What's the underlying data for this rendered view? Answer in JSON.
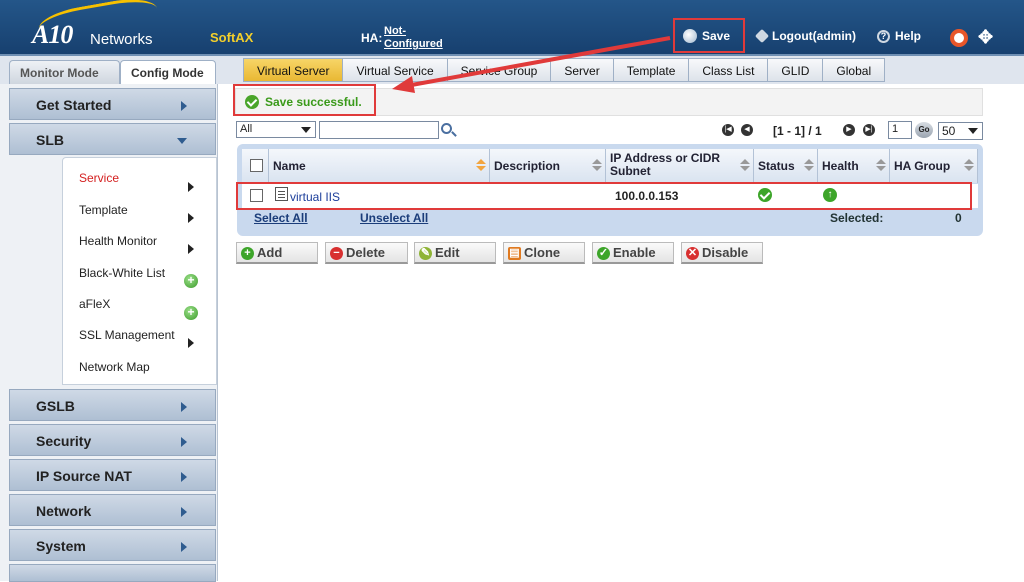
{
  "header": {
    "logo_a10": "A10",
    "logo_networks": "Networks",
    "product": "SoftAX",
    "ha_label": "HA:",
    "ha_value": "Not-Configured",
    "save_label": "Save",
    "logout_label": "Logout(admin)",
    "help_label": "Help"
  },
  "modes": {
    "monitor": "Monitor Mode",
    "config": "Config Mode"
  },
  "tabs": [
    {
      "label": "Virtual Server",
      "active": true
    },
    {
      "label": "Virtual Service"
    },
    {
      "label": "Service Group"
    },
    {
      "label": "Server"
    },
    {
      "label": "Template"
    },
    {
      "label": "Class List"
    },
    {
      "label": "GLID"
    },
    {
      "label": "Global"
    }
  ],
  "sidebar": {
    "get_started": "Get Started",
    "slb": "SLB",
    "slb_items": [
      "Service",
      "Template",
      "Health Monitor",
      "Black-White List",
      "aFleX",
      "SSL Management",
      "Network Map"
    ],
    "gslb": "GSLB",
    "security": "Security",
    "ip_source_nat": "IP Source NAT",
    "network": "Network",
    "system": "System"
  },
  "message": "Save successful.",
  "filter": {
    "select_value": "All",
    "search_value": ""
  },
  "pager": {
    "range": "[1 - 1] / 1",
    "page": "1",
    "go": "Go",
    "page_size": "50"
  },
  "table": {
    "columns": [
      "Name",
      "Description",
      "IP Address or CIDR Subnet",
      "Status",
      "Health",
      "HA Group"
    ],
    "rows": [
      {
        "name": "virtual IIS",
        "description": "",
        "ip": "100.0.0.153",
        "status": "ok",
        "health": "up",
        "ha_group": ""
      }
    ],
    "select_all": "Select All",
    "unselect_all": "Unselect All",
    "selected_label": "Selected:",
    "selected_count": "0"
  },
  "actions": {
    "add": "Add",
    "delete": "Delete",
    "edit": "Edit",
    "clone": "Clone",
    "enable": "Enable",
    "disable": "Disable"
  }
}
